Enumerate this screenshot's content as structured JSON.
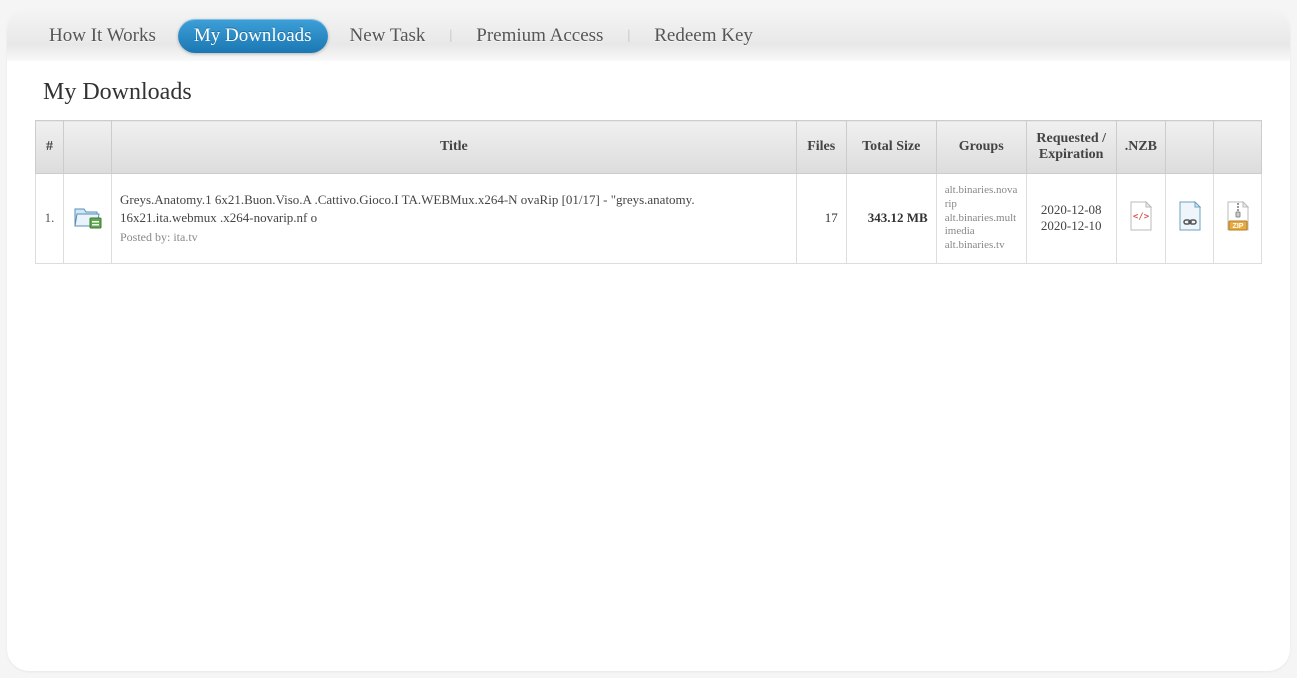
{
  "nav": {
    "items": [
      {
        "label": "How It Works",
        "active": false
      },
      {
        "label": "My Downloads",
        "active": true
      },
      {
        "label": "New Task",
        "active": false
      },
      {
        "label": "Premium Access",
        "active": false
      },
      {
        "label": "Redeem Key",
        "active": false
      }
    ]
  },
  "page": {
    "title": "My Downloads"
  },
  "table": {
    "headers": {
      "num": "#",
      "icon": "",
      "title": "Title",
      "files": "Files",
      "size": "Total Size",
      "groups": "Groups",
      "dates": "Requested / Expiration",
      "nzb": ".NZB",
      "link": "",
      "zip": ""
    },
    "rows": [
      {
        "num": "1.",
        "title": "Greys.Anatomy.1 6x21.Buon.Viso.A .Cattivo.Gioco.I TA.WEBMux.x264-N ovaRip [01/17] - \"greys.anatomy. 16x21.ita.webmux .x264-novarip.nf o",
        "posted_by_label": "Posted by: ",
        "posted_by_value": "ita.tv",
        "files": "17",
        "size": "343.12 MB",
        "groups": [
          "alt.binaries.novarip",
          "alt.binaries.multimedia",
          "alt.binaries.tv"
        ],
        "requested": "2020-12-08",
        "expiration": "2020-12-10"
      }
    ]
  }
}
